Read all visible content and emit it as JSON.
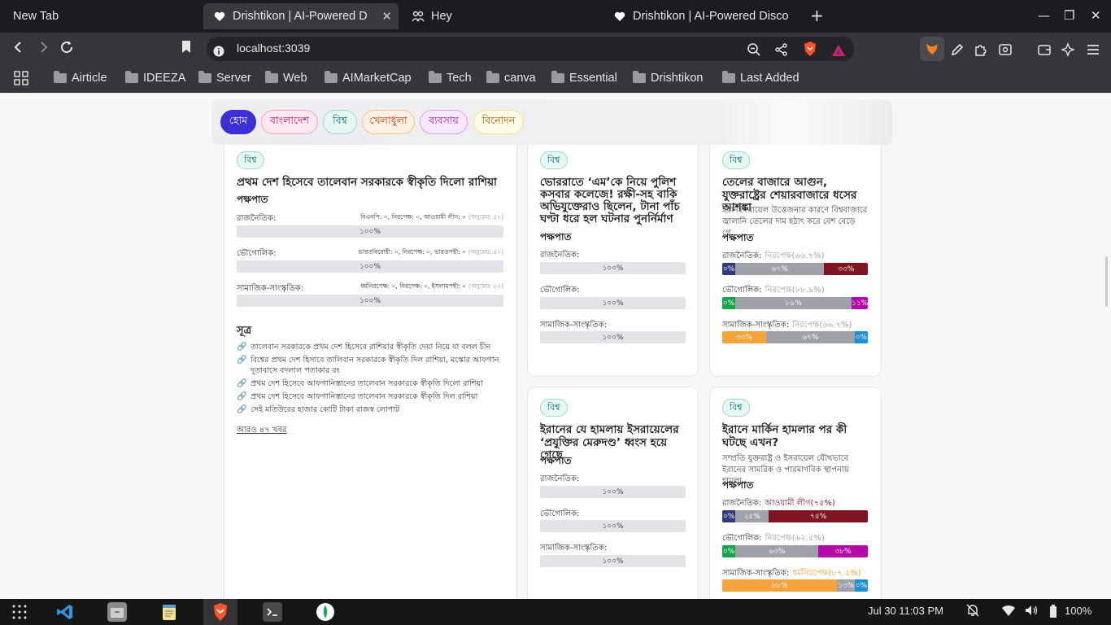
{
  "browser": {
    "tabs": [
      {
        "title": "New Tab"
      },
      {
        "title": "Drishtikon | AI-Powered D",
        "active": true
      },
      {
        "title": "Hey"
      },
      {
        "title": "Drishtikon | AI-Powered Disco"
      }
    ],
    "url": "localhost:3039",
    "bookmarks": [
      "Airticle",
      "IDEEZA",
      "Server",
      "Web",
      "AIMarketCap",
      "Tech",
      "canva",
      "Essential",
      "Drishtikon",
      "Last Added"
    ]
  },
  "categories": [
    {
      "label": "হোম",
      "active": true
    },
    {
      "label": "বাংলাদেশ"
    },
    {
      "label": "বিশ্ব"
    },
    {
      "label": "খেলাধুলা"
    },
    {
      "label": "ব্যবসায়"
    },
    {
      "label": "বিনোদন"
    }
  ],
  "featured": {
    "tag": "বিশ্ব",
    "title": "প্রথম দেশ হিসেবে তালেবান সরকারকে স্বীকৃতি দিলো রাশিয়া",
    "bias_heading": "পক্ষপাত",
    "bias": [
      {
        "label": "রাজনৈতিক:",
        "meta": "বিএনপি: ০, নিরপেক্ষ: ০, আওয়ামী লীগ: ০",
        "approx": "(অনুমেয়: ৫২)",
        "bar": "১০০%"
      },
      {
        "label": "ভৌগোলিক:",
        "meta": "ভারতবিরোধী: ০, নিরপেক্ষ: ০, ভারতপন্থী: ০",
        "approx": "(অনুমেয়: ৫২)",
        "bar": "১০০%"
      },
      {
        "label": "সামাজিক-সাংস্কৃতিক:",
        "meta": "ধর্মনিরপেক্ষ: ০, নিরপেক্ষ: ০, ইসলামপন্থী: ০",
        "approx": "(অনুমেয়: ৫২)",
        "bar": "১০০%"
      }
    ],
    "sources_heading": "সূত্র",
    "sources": [
      "তালেবান সরকারকে প্রথম দেশ হিসেবে রাশিয়ার স্বীকৃতি দেয়া নিয়ে যা বলল চীন",
      "বিশ্বের প্রথম দেশ হিসাবে তালিবান সরকারকে স্বীকৃতি দিল রাশিয়া, মস্কোর আফগান দূতাবাসে বদলাল পতাকার রং",
      "প্রথম দেশ হিসেবে আফগানিস্তানের তালেবান সরকারকে স্বীকৃতি দিলো রাশিয়া",
      "প্রথম দেশ হিসেবে আফগানিস্তানের তালেবান সরকারকে স্বীকৃতি দিল রাশিয়া",
      "সেই মতিউরের হাজার কোটি টাকা রাজস্ব লোপাট"
    ],
    "more": "আরও ৪৭ খবর"
  },
  "cards": [
    {
      "tag": "বিশ্ব",
      "title": "ভোররাতে ‘এম’কে নিয়ে পুলিশ কসবার কলেজে! রক্ষী-সহ বাকি অভিযুক্তেরাও ছিলেন, টানা পাঁচ ঘণ্টা ধরে হল ঘটনার পুনর্নির্মাণ",
      "bias_heading": "পক্ষপাত",
      "bias": [
        {
          "label": "রাজনৈতিক:",
          "bar": "১০০%"
        },
        {
          "label": "ভৌগোলিক:",
          "bar": "১০০%"
        },
        {
          "label": "সামাজিক-সাংস্কৃতিক:",
          "bar": "১০০%"
        }
      ]
    },
    {
      "tag": "বিশ্ব",
      "title": "তেলের বাজারে আগুন, যুক্তরাষ্ট্রের শেয়ারবাজারে ধসের আশঙ্কা",
      "description": "ইরানইসরায়েল উত্তেজনার কারণে বিশ্ববাজারে জ্বালানি তেলের দাম হঠাৎ করে বেশ বেড়ে গে...",
      "bias_heading": "পক্ষপাত",
      "bias": [
        {
          "label": "রাজনৈতিক:",
          "lean": "নিরপেক্ষ(৬৬.৭%)",
          "lean_color": "#9aa0a6",
          "segments": [
            {
              "text": "০%",
              "fraction": 0.09,
              "color": "#2e3a7a"
            },
            {
              "text": "৬৭%",
              "fraction": 0.61,
              "color": "#9ea2a8"
            },
            {
              "text": "৩৩%",
              "fraction": 0.3,
              "color": "#7f1422"
            }
          ]
        },
        {
          "label": "ভৌগোলিক:",
          "lean": "নিরপেক্ষ(৮৮.৯%)",
          "lean_color": "#9aa0a6",
          "segments": [
            {
              "text": "০%",
              "fraction": 0.09,
              "color": "#17a34a"
            },
            {
              "text": "৮৯%",
              "fraction": 0.8,
              "color": "#9ea2a8"
            },
            {
              "text": "১১%",
              "fraction": 0.11,
              "color": "#b40aa8"
            }
          ]
        },
        {
          "label": "সামাজিক-সাংস্কৃতিক:",
          "lean": "নিরপেক্ষ(৬৬.৭%)",
          "lean_color": "#9aa0a6",
          "segments": [
            {
              "text": "৩৩%",
              "fraction": 0.3,
              "color": "#f4a43a"
            },
            {
              "text": "৬৭%",
              "fraction": 0.61,
              "color": "#9ea2a8"
            },
            {
              "text": "০%",
              "fraction": 0.09,
              "color": "#1d8fd6"
            }
          ]
        }
      ]
    },
    {
      "tag": "বিশ্ব",
      "title": "ইরানের যে হামলায় ইসরায়েলের ‘প্রযুক্তির মেরুদণ্ড’ ধ্বংস হয়ে গেছে",
      "bias_heading": "পক্ষপাত",
      "bias": [
        {
          "label": "রাজনৈতিক:",
          "bar": "১০০%"
        },
        {
          "label": "ভৌগোলিক:",
          "bar": "১০০%"
        },
        {
          "label": "সামাজিক-সাংস্কৃতিক:",
          "bar": "১০০%"
        }
      ]
    },
    {
      "tag": "বিশ্ব",
      "title": "ইরানে মার্কিন হামলার পর কী ঘটছে এখন?",
      "description": "সম্প্রতি যুক্তরাষ্ট্র ও ইসরায়েল যৌথভাবে ইরানের সামরিক ও পারমাণবিক স্থাপনায় হামলা...",
      "bias_heading": "পক্ষপাত",
      "bias": [
        {
          "label": "রাজনৈতিক:",
          "lean": "আওয়ামী লীগ(৭৫%)",
          "lean_color": "#8b1a2b",
          "segments": [
            {
              "text": "০%",
              "fraction": 0.09,
              "color": "#2e3a7a"
            },
            {
              "text": "২৫%",
              "fraction": 0.23,
              "color": "#9ea2a8"
            },
            {
              "text": "৭৫%",
              "fraction": 0.68,
              "color": "#7f1422"
            }
          ]
        },
        {
          "label": "ভৌগোলিক:",
          "lean": "নিরপেক্ষ(৬২.৫%)",
          "lean_color": "#9aa0a6",
          "segments": [
            {
              "text": "০%",
              "fraction": 0.09,
              "color": "#17a34a"
            },
            {
              "text": "৬৩%",
              "fraction": 0.57,
              "color": "#9ea2a8"
            },
            {
              "text": "৩৮%",
              "fraction": 0.34,
              "color": "#b40aa8"
            }
          ]
        },
        {
          "label": "সামাজিক-সাংস্কৃতিক:",
          "lean": "ধর্মনিরপেক্ষ(৮৭.৫%)",
          "lean_color": "#f4a43a",
          "segments": [
            {
              "text": "৮৮%",
              "fraction": 0.79,
              "color": "#f4a43a"
            },
            {
              "text": "১৩%",
              "fraction": 0.12,
              "color": "#9ea2a8"
            },
            {
              "text": "০%",
              "fraction": 0.09,
              "color": "#1d8fd6"
            }
          ]
        }
      ]
    }
  ],
  "taskbar": {
    "datetime": "Jul 30  11:03 PM",
    "battery": "100%"
  }
}
